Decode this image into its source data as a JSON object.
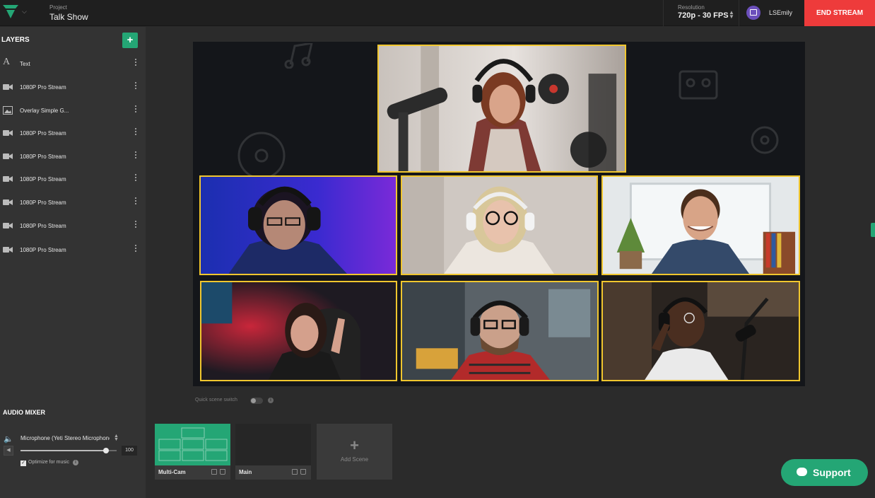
{
  "header": {
    "project_label": "Project",
    "project_name": "Talk Show",
    "resolution_label": "Resolution",
    "resolution_value": "720p - 30 FPS",
    "username": "LSEmily",
    "end_stream_label": "END STREAM",
    "accent_color": "#ee3b3b"
  },
  "layers": {
    "title": "LAYERS",
    "add_icon": "plus-icon",
    "items": [
      {
        "label": "Text",
        "icon": "text-icon"
      },
      {
        "label": "1080P Pro Stream",
        "icon": "camera-icon"
      },
      {
        "label": "Overlay Simple G...",
        "icon": "image-icon"
      },
      {
        "label": "1080P Pro Stream",
        "icon": "camera-icon"
      },
      {
        "label": "1080P Pro Stream",
        "icon": "camera-icon"
      },
      {
        "label": "1080P Pro Stream",
        "icon": "camera-icon"
      },
      {
        "label": "1080P Pro Stream",
        "icon": "camera-icon"
      },
      {
        "label": "1080P Pro Stream",
        "icon": "camera-icon"
      },
      {
        "label": "1080P Pro Stream",
        "icon": "camera-icon"
      }
    ]
  },
  "audio_mixer": {
    "title": "AUDIO MIXER",
    "device": "Microphone (Yeti Stereo Microphone)",
    "volume": "100",
    "volume_fraction": 0.89,
    "optimize_label": "Optimize for music",
    "optimize_checked": true
  },
  "canvas": {
    "highlight_color": "#f0c62e"
  },
  "scenes": {
    "quick_switch_label": "Quick scene switch",
    "quick_switch_on": false,
    "items": [
      {
        "label": "Multi-Cam",
        "active": true
      },
      {
        "label": "Main",
        "active": false
      }
    ],
    "add_label": "Add Scene"
  },
  "support": {
    "label": "Support",
    "color": "#24a675"
  }
}
